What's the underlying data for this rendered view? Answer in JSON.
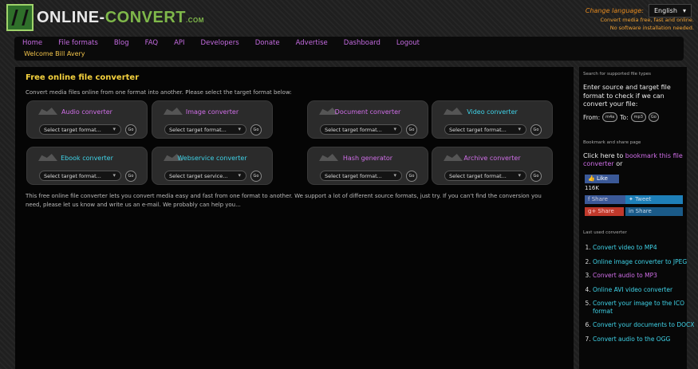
{
  "header": {
    "logo_text_1": "ONLINE-",
    "logo_text_2": "CONVERT",
    "logo_com": ".COM",
    "language_label": "Change language:",
    "language_value": "English",
    "tagline_1": "Convert media free, fast and online.",
    "tagline_2": "No software installation needed."
  },
  "nav": {
    "items": [
      "Home",
      "File formats",
      "Blog",
      "FAQ",
      "API",
      "Developers",
      "Donate",
      "Advertise",
      "Dashboard",
      "Logout"
    ],
    "welcome": "Welcome Bill Avery"
  },
  "main": {
    "title": "Free online file converter",
    "intro": "Convert media files online from one format into another. Please select the target format below:",
    "go_label": "Go",
    "cards": [
      {
        "name": "Audio converter",
        "placeholder": "Select target format...",
        "color": "#d06ee8"
      },
      {
        "name": "Image converter",
        "placeholder": "Select target format...",
        "color": "#d06ee8"
      },
      {
        "name": "Document converter",
        "placeholder": "Select target format...",
        "color": "#d06ee8"
      },
      {
        "name": "Video converter",
        "placeholder": "Select target format...",
        "color": "#3fd3e8"
      },
      {
        "name": "Ebook converter",
        "placeholder": "Select target format...",
        "color": "#3fd3e8"
      },
      {
        "name": "Webservice converter",
        "placeholder": "Select target service...",
        "color": "#3fd3e8"
      },
      {
        "name": "Hash generator",
        "placeholder": "Select target format...",
        "color": "#d06ee8"
      },
      {
        "name": "Archive converter",
        "placeholder": "Select target format...",
        "color": "#d06ee8"
      }
    ],
    "description": "This free online file converter lets you convert media easy and fast from one format to another. We support a lot of different source formats, just try. If you can't find the conversion you need, please let us know and write us an e-mail. We probably can help you..."
  },
  "sidebar": {
    "search_heading": "Search for supported file types",
    "search_text": "Enter source and target file format to check if we can convert your file:",
    "from_label": "From:",
    "from_value": "m4a",
    "to_label": "To:",
    "to_value": "mp3",
    "go_label": "Go",
    "bookmark_heading": "Bookmark and share page",
    "bookmark_prefix": "Click here to",
    "bookmark_link": "bookmark this file converter",
    "bookmark_suffix": "or",
    "like_label": "Like",
    "like_count": "116K",
    "share_labels": [
      "Share",
      "Tweet",
      "Share",
      "Share"
    ],
    "last_used_heading": "Last used converter",
    "last_used": [
      {
        "label": "Convert video to MP4",
        "color": "#3fd3e8"
      },
      {
        "label": "Online image converter to JPEG",
        "color": "#3fd3e8"
      },
      {
        "label": "Convert audio to MP3",
        "color": "#d06ee8"
      },
      {
        "label": "Online AVI video converter",
        "color": "#3fd3e8"
      },
      {
        "label": "Convert your image to the ICO format",
        "color": "#3fd3e8"
      },
      {
        "label": "Convert your documents to DOCX",
        "color": "#3fd3e8"
      },
      {
        "label": "Convert audio to the OGG",
        "color": "#3fd3e8"
      }
    ]
  }
}
